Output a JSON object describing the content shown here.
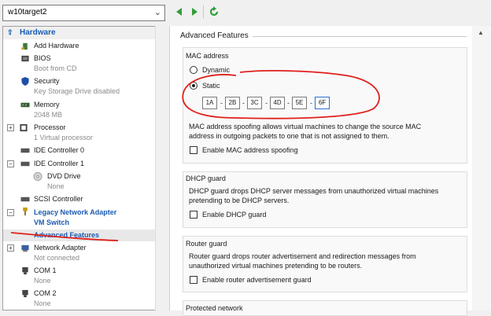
{
  "toolbar": {
    "vm_name": "w10target2",
    "colors": {
      "nav_green": "#2e9e38",
      "link_blue": "#1a5ab1"
    }
  },
  "sidebar": {
    "header": "Hardware",
    "items": {
      "add_hardware": "Add Hardware",
      "bios": {
        "label": "BIOS",
        "sub": "Boot from CD"
      },
      "security": {
        "label": "Security",
        "sub": "Key Storage Drive disabled"
      },
      "memory": {
        "label": "Memory",
        "sub": "2048 MB"
      },
      "processor": {
        "label": "Processor",
        "sub": "1 Virtual processor"
      },
      "ide0": {
        "label": "IDE Controller 0"
      },
      "ide1": {
        "label": "IDE Controller 1"
      },
      "dvd": {
        "label": "DVD Drive",
        "sub": "None"
      },
      "scsi": {
        "label": "SCSI Controller"
      },
      "legacy_net": {
        "label": "Legacy Network Adapter"
      },
      "vm_switch": {
        "label": "VM Switch"
      },
      "advanced": {
        "label": "Advanced Features"
      },
      "net_adapter": {
        "label": "Network Adapter",
        "sub": "Not connected"
      },
      "com1": {
        "label": "COM 1",
        "sub": "None"
      },
      "com2": {
        "label": "COM 2",
        "sub": "None"
      }
    }
  },
  "main": {
    "title": "Advanced Features",
    "mac": {
      "title": "MAC address",
      "dynamic_label": "Dynamic",
      "static_label": "Static",
      "selected": "static",
      "octets": [
        "1A",
        "2B",
        "3C",
        "4D",
        "5E",
        "6F"
      ],
      "spoof_desc_1": "MAC address spoofing allows virtual machines to change the source MAC",
      "spoof_desc_2": "address in outgoing packets to one that is not assigned to them.",
      "spoof_label": "Enable MAC address spoofing",
      "spoof_checked": false
    },
    "dhcp": {
      "title": "DHCP guard",
      "desc_1": "DHCP guard drops DHCP server messages from unauthorized virtual machines",
      "desc_2": "pretending to be DHCP servers.",
      "label": "Enable DHCP guard",
      "checked": false
    },
    "router": {
      "title": "Router guard",
      "desc_1": "Router guard drops router advertisement and redirection messages from",
      "desc_2": "unauthorized virtual machines pretending to be routers.",
      "label": "Enable router advertisement guard",
      "checked": false
    },
    "protected": {
      "title": "Protected network"
    }
  }
}
